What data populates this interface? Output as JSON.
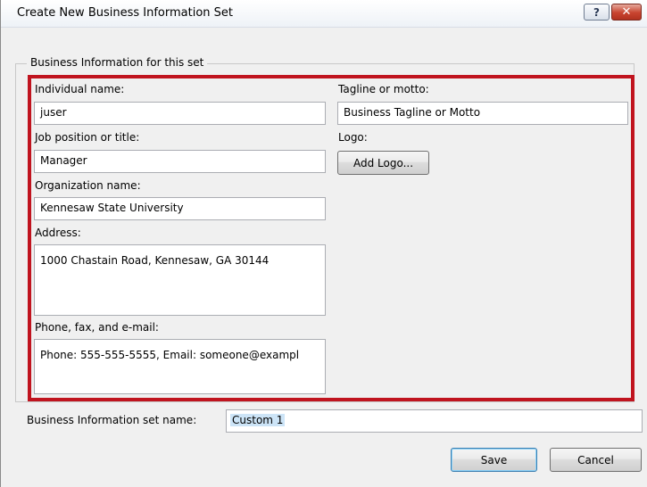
{
  "window": {
    "title": "Create New Business Information Set",
    "help_label": "?",
    "close_label": "✕"
  },
  "group": {
    "legend": "Business Information for this set"
  },
  "fields": {
    "individual_name": {
      "label": "Individual name:",
      "value": "juser"
    },
    "job_title": {
      "label": "Job position or title:",
      "value": "Manager"
    },
    "organization": {
      "label": "Organization name:",
      "value": "Kennesaw State University"
    },
    "address": {
      "label": "Address:",
      "value": "1000 Chastain Road, Kennesaw, GA 30144"
    },
    "contact": {
      "label": "Phone, fax, and e-mail:",
      "value": "Phone: 555-555-5555, Email: someone@exampl"
    },
    "tagline": {
      "label": "Tagline or motto:",
      "value": "Business Tagline or Motto"
    },
    "logo": {
      "label": "Logo:",
      "button": "Add Logo..."
    }
  },
  "set_name": {
    "label": "Business Information set name:",
    "value": "Custom 1"
  },
  "buttons": {
    "save": "Save",
    "cancel": "Cancel"
  },
  "colors": {
    "highlight_border": "#c0141f",
    "dialog_bg": "#f0f0f0"
  }
}
